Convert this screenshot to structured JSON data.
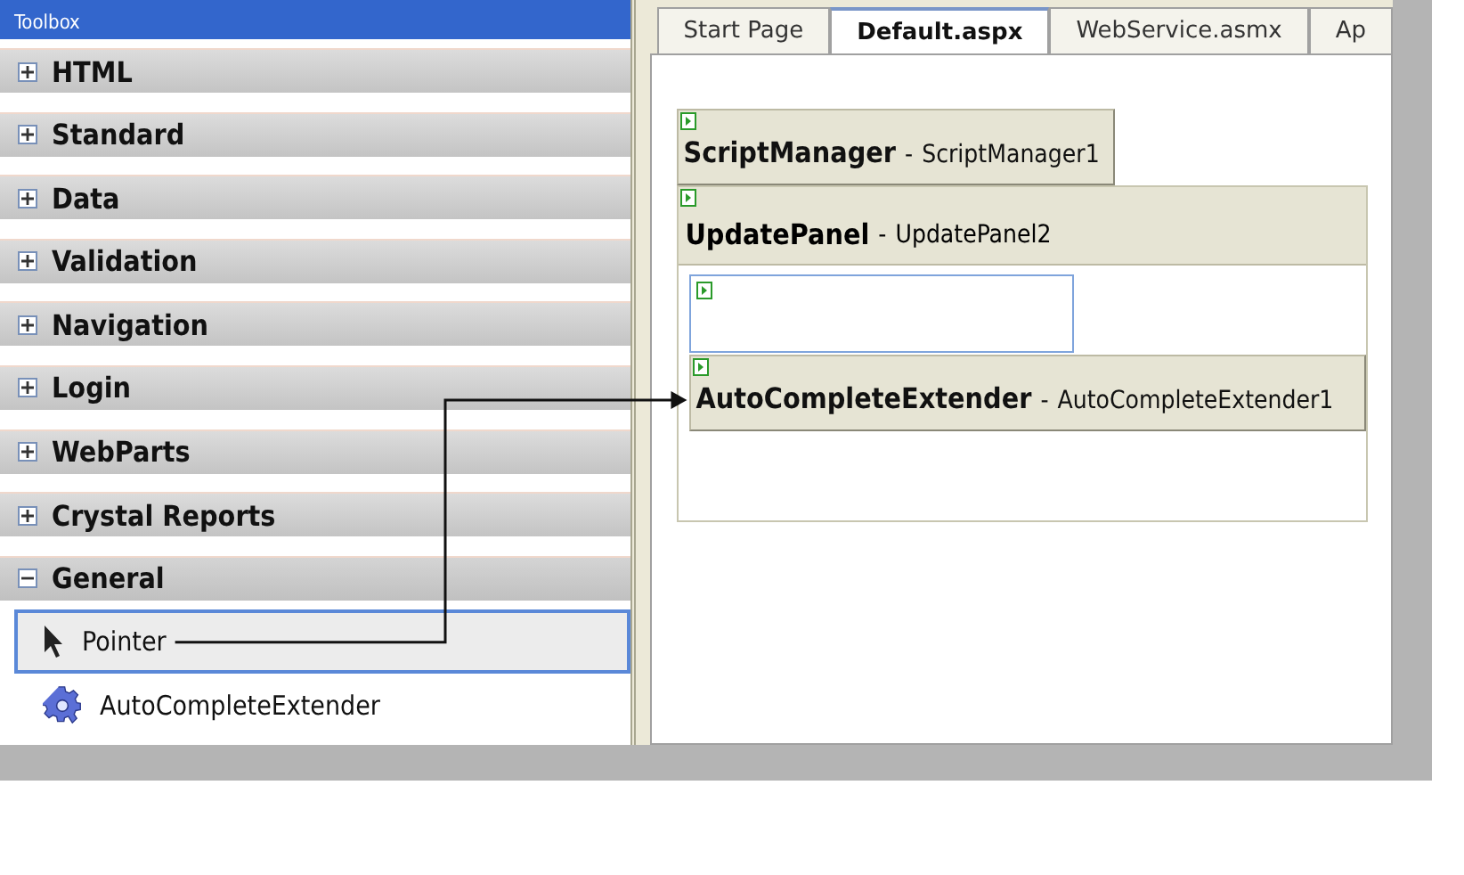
{
  "toolbox": {
    "title": "Toolbox",
    "categories": [
      {
        "label": "HTML",
        "expanded": false
      },
      {
        "label": "Standard",
        "expanded": false
      },
      {
        "label": "Data",
        "expanded": false
      },
      {
        "label": "Validation",
        "expanded": false
      },
      {
        "label": "Navigation",
        "expanded": false
      },
      {
        "label": "Login",
        "expanded": false
      },
      {
        "label": "WebParts",
        "expanded": false
      },
      {
        "label": "Crystal Reports",
        "expanded": false
      },
      {
        "label": "General",
        "expanded": true,
        "items": [
          {
            "label": "Pointer",
            "kind": "pointer",
            "selected": true
          },
          {
            "label": "AutoCompleteExtender",
            "kind": "component",
            "selected": false
          }
        ]
      }
    ]
  },
  "tabs": [
    {
      "label": "Start Page",
      "selected": false
    },
    {
      "label": "Default.aspx",
      "selected": true
    },
    {
      "label": "WebService.asmx",
      "selected": false
    },
    {
      "label": "Ap",
      "selected": false
    }
  ],
  "design": {
    "controls": [
      {
        "kind": "tag",
        "type": "ScriptManager",
        "separator": "-",
        "name": "ScriptManager1"
      },
      {
        "kind": "panel",
        "type": "UpdatePanel",
        "separator": "-",
        "name": "UpdatePanel2",
        "children": [
          {
            "kind": "template"
          },
          {
            "kind": "tag",
            "type": "AutoCompleteExtender",
            "separator": "-",
            "name": "AutoCompleteExtender1",
            "drop_target": true
          }
        ]
      }
    ]
  }
}
